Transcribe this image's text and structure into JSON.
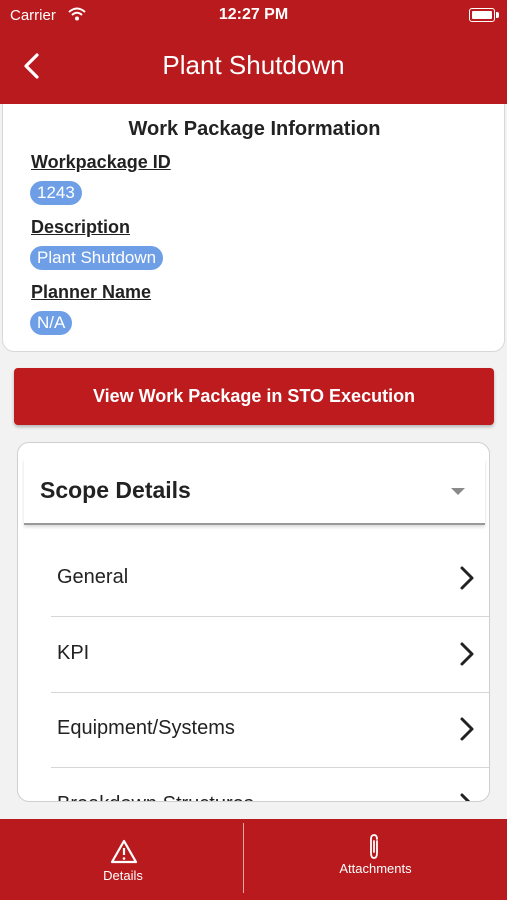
{
  "status_bar": {
    "carrier": "Carrier",
    "time": "12:27 PM"
  },
  "nav": {
    "title": "Plant Shutdown",
    "back_icon": "chevron-left-icon"
  },
  "info": {
    "title": "Work Package Information",
    "fields": [
      {
        "label": "Workpackage ID",
        "value": "1243"
      },
      {
        "label": "Description",
        "value": "Plant Shutdown"
      },
      {
        "label": "Planner Name",
        "value": "N/A"
      }
    ]
  },
  "view_button": {
    "label": "View Work Package in STO Execution"
  },
  "scope": {
    "title": "Scope Details",
    "items": [
      {
        "label": "General"
      },
      {
        "label": "KPI"
      },
      {
        "label": "Equipment/Systems"
      },
      {
        "label": "Breakdown Structures"
      }
    ]
  },
  "tabs": [
    {
      "label": "Details",
      "icon": "warning-triangle-icon"
    },
    {
      "label": "Attachments",
      "icon": "paperclip-icon"
    }
  ],
  "colors": {
    "brand_red": "#b81a1d",
    "chip_blue": "#6e9fe6"
  }
}
